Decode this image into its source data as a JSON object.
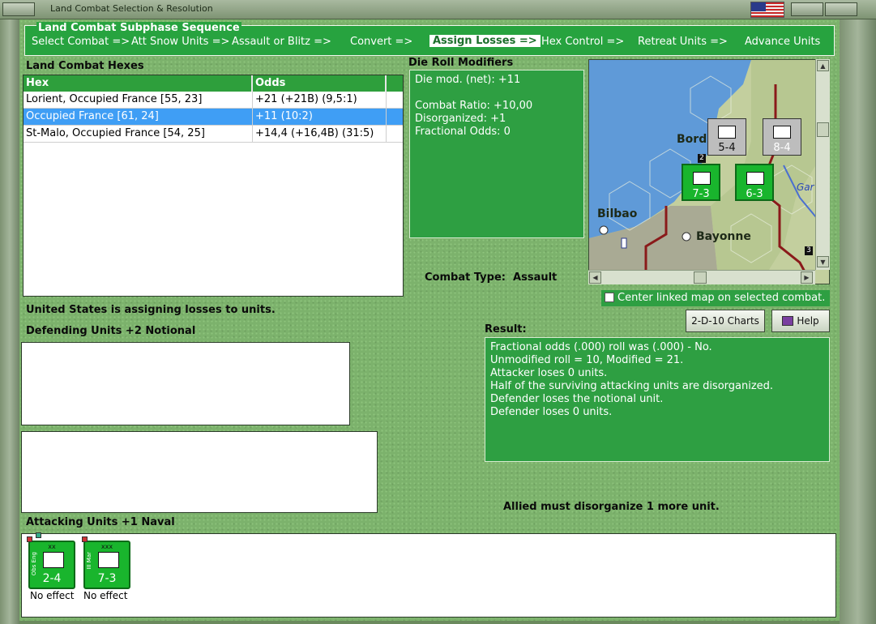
{
  "window": {
    "title": "Land Combat Selection & Resolution"
  },
  "phases": {
    "legend": "Land Combat Subphase Sequence",
    "items": [
      "Select Combat =>",
      "Att Snow Units =>",
      "Assault or Blitz =>",
      "Convert =>",
      "Assign Losses =>",
      "Hex Control =>",
      "Retreat Units =>",
      "Advance Units"
    ],
    "active_index": 4
  },
  "hexes": {
    "title": "Land Combat Hexes",
    "columns": [
      "Hex",
      "Odds"
    ],
    "rows": [
      [
        "Lorient, Occupied France [55, 23]",
        "+21 (+21B) (9,5:1)"
      ],
      [
        "Occupied France [61, 24]",
        "+11 (10:2)"
      ],
      [
        "St-Malo, Occupied France [54, 25]",
        "+14,4 (+16,4B) (31:5)"
      ]
    ],
    "selected_index": 1
  },
  "modifiers": {
    "title": "Die Roll Modifiers",
    "lines": [
      "Die mod. (net): +11",
      "",
      "Combat Ratio: +10,00",
      "Disorganized: +1",
      "Fractional Odds: 0"
    ]
  },
  "combat_type": {
    "label": "Combat Type:",
    "value": "Assault"
  },
  "map": {
    "labels": [
      "Bord",
      "Bilbao",
      "Bayonne",
      "Gar"
    ],
    "units": [
      {
        "name": "infantry-corps",
        "value": "5-4",
        "size": "xxx"
      },
      {
        "name": "infantry-corps",
        "value": "8-4",
        "size": "xxx"
      },
      {
        "name": "marine-corps",
        "value": "7-3",
        "size": "xxx"
      },
      {
        "name": "infantry-corps",
        "value": "6-3",
        "size": "xxx"
      }
    ],
    "stack_counts": [
      "2",
      "3"
    ]
  },
  "center_map": {
    "label": "Center linked map on selected combat.",
    "checked": false
  },
  "status": "United States is assigning losses to units.",
  "defending": {
    "title": "Defending Units +2 Notional"
  },
  "buttons": {
    "charts": "2-D-10 Charts",
    "help": "Help"
  },
  "result": {
    "title": "Result:",
    "lines": [
      "Fractional odds (.000) roll was (.000)  - No.",
      "Unmodified roll = 10, Modified = 21.",
      "Attacker loses 0 units.",
      "Half of the surviving attacking units are disorganized.",
      "Defender loses the notional unit.",
      "Defender loses 0 units."
    ]
  },
  "notice": "Allied must disorganize 1 more unit.",
  "attacking": {
    "title": "Attacking Units +1 Naval",
    "units": [
      {
        "size": "xx",
        "side": "Obs Eng",
        "value": "2-4",
        "effect": "No effect"
      },
      {
        "size": "xxx",
        "side": "III Mar",
        "value": "7-3",
        "effect": "No effect"
      }
    ]
  },
  "colors": {
    "panel_green": "#2e9f42",
    "selection_blue": "#3f9ef5",
    "unit_green": "#19b52d"
  }
}
